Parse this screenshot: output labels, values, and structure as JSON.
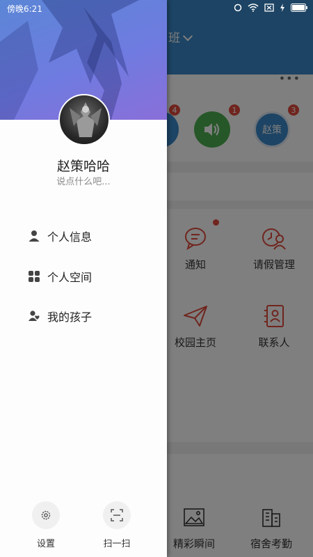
{
  "status_bar": {
    "time": "傍晚6:21"
  },
  "header": {
    "class_title": "班"
  },
  "quick_icons": [
    {
      "name": "volume",
      "badge": "4"
    },
    {
      "name": "speaker",
      "badge": "1"
    },
    {
      "name": "user",
      "label": "赵策",
      "badge": "3"
    }
  ],
  "grid": [
    {
      "label": "通知"
    },
    {
      "label": "请假管理"
    },
    {
      "label": "校园主页"
    },
    {
      "label": "联系人"
    }
  ],
  "bottom_tabs": [
    {
      "label": "精彩瞬间"
    },
    {
      "label": "宿舍考勤"
    }
  ],
  "drawer": {
    "user_name": "赵策哈哈",
    "signature": "说点什么吧...",
    "menu": [
      {
        "label": "个人信息",
        "icon": "person-icon"
      },
      {
        "label": "个人空间",
        "icon": "grid-icon"
      },
      {
        "label": "我的孩子",
        "icon": "child-icon"
      }
    ],
    "settings_label": "设置",
    "scan_label": "扫一扫"
  },
  "colors": {
    "header": "#3b88c8",
    "accent_red": "#e04a3c",
    "green": "#4caf50"
  }
}
